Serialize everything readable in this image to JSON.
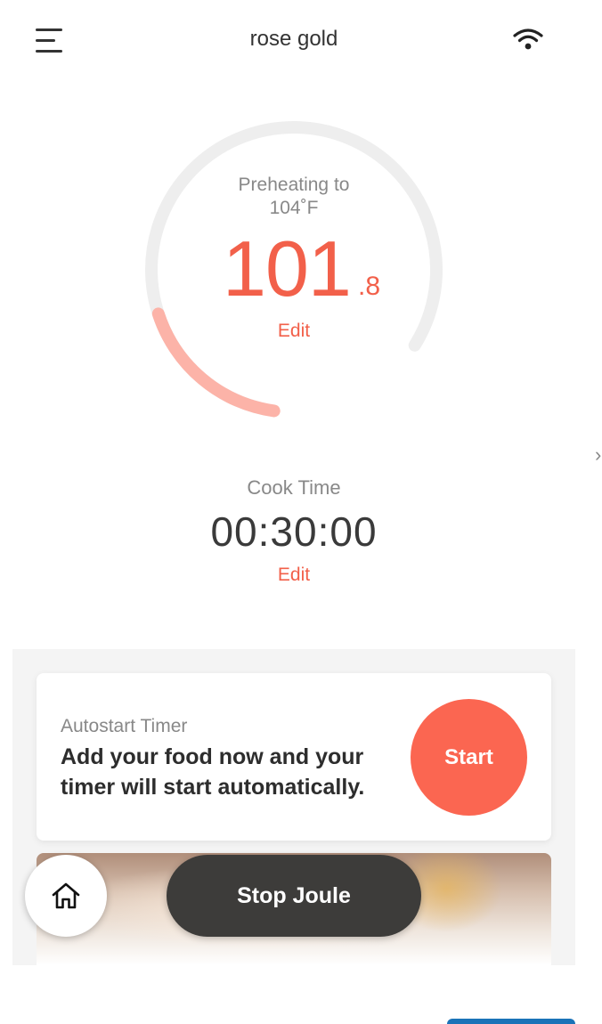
{
  "header": {
    "title": "rose gold",
    "menu_icon": "hamburger-menu-icon",
    "wifi_icon": "wifi-icon"
  },
  "dial": {
    "status_line1": "Preheating to",
    "target_temp": "104˚F",
    "current_temp_whole": "101",
    "current_temp_decimal": ".8",
    "edit_label": "Edit",
    "progress_fraction": 0.22,
    "track_color": "#eeeeee",
    "progress_color": "#fcb3a8",
    "accent_color": "#f2604a"
  },
  "side_nav": {
    "icon": "chevron-right-icon",
    "glyph": "›"
  },
  "cook_time": {
    "label": "Cook Time",
    "value": "00:30:00",
    "edit_label": "Edit"
  },
  "autostart": {
    "title": "Autostart Timer",
    "description": "Add your food now and your timer will start automatically.",
    "start_label": "Start",
    "start_color": "#fb6651"
  },
  "bottom_bar": {
    "home_icon": "home-icon",
    "stop_label": "Stop Joule"
  }
}
